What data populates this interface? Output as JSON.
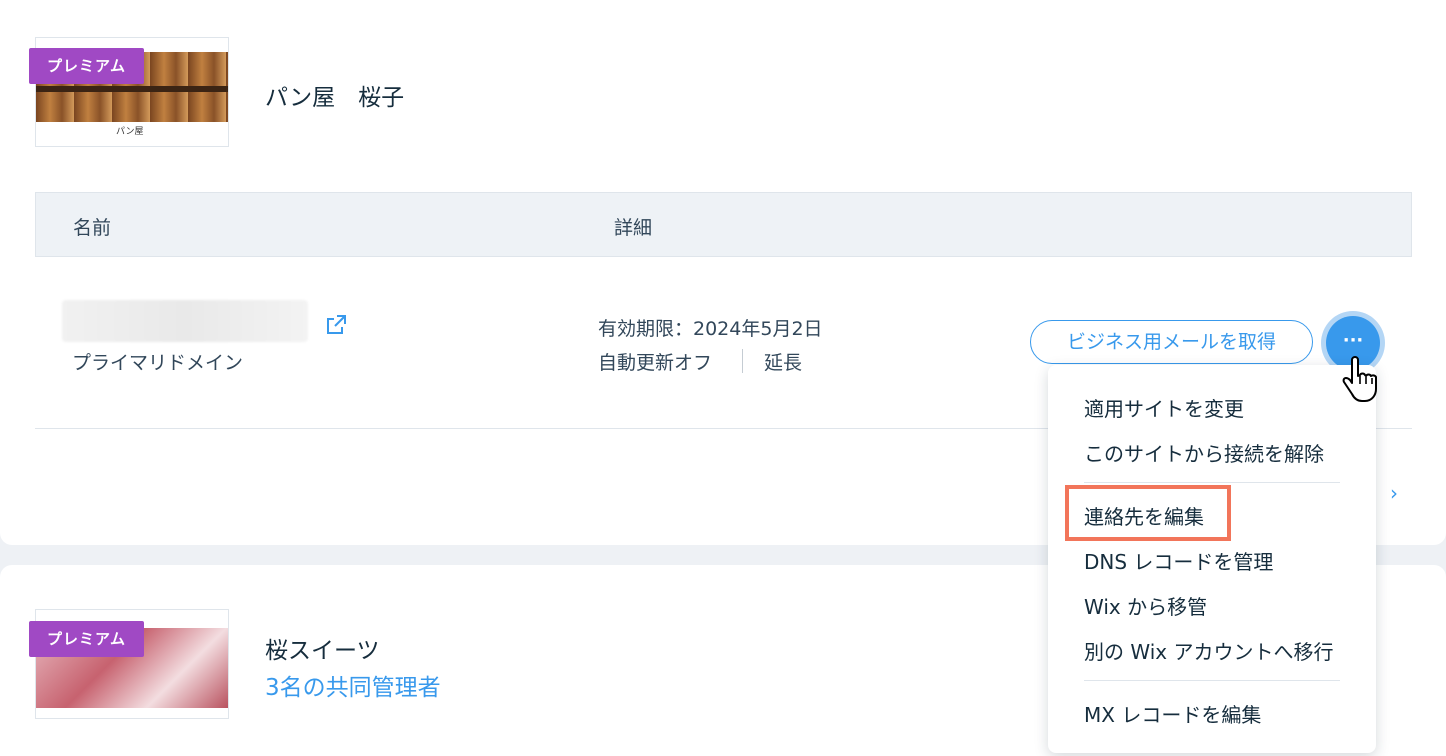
{
  "sites": [
    {
      "badge": "プレミアム",
      "name": "パン屋　桜子",
      "thumb_text": "パン屋"
    },
    {
      "badge": "プレミアム",
      "name": "桜スイーツ",
      "collaborators": "3名の共同管理者"
    }
  ],
  "table": {
    "col_name": "名前",
    "col_details": "詳細"
  },
  "domain_row": {
    "type_label": "プライマリドメイン",
    "expiry": "有効期限：2024年5月2日",
    "auto_renew": "自動更新オフ",
    "extend_link": "延長",
    "biz_email_button": "ビジネス用メールを取得",
    "more_button": "···"
  },
  "menu": {
    "items": [
      "適用サイトを変更",
      "このサイトから接続を解除",
      "連絡先を編集",
      "DNS レコードを管理",
      "Wix から移管",
      "別の Wix アカウントへ移行",
      "MX レコードを編集"
    ]
  },
  "colors": {
    "accent": "#3899ec",
    "premium": "#a049c4",
    "highlight": "#f2755a"
  }
}
